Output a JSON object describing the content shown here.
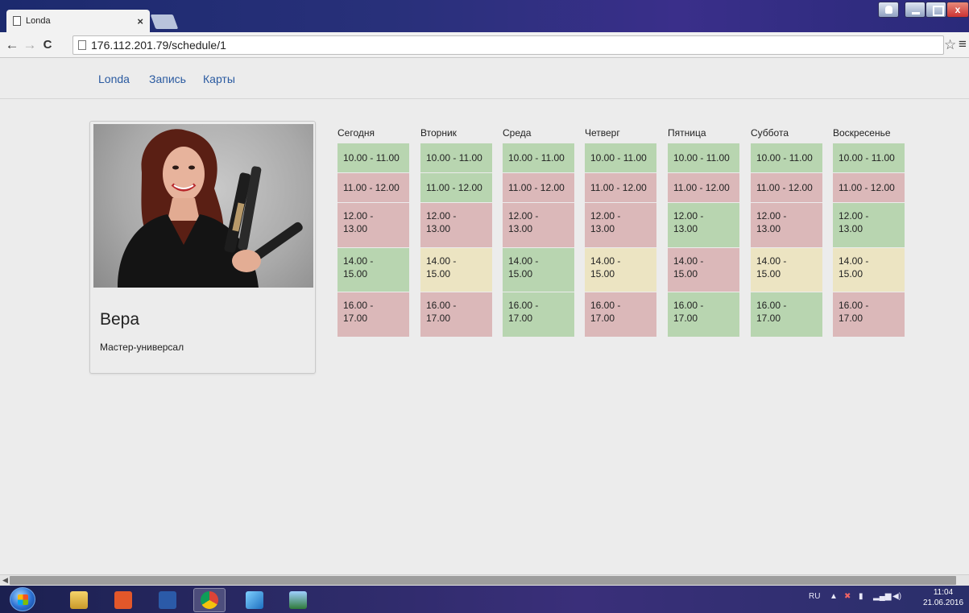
{
  "browser": {
    "tab_title": "Londa",
    "tab_close": "×",
    "url": "176.112.201.79/schedule/1",
    "back": "←",
    "forward": "→",
    "reload": "C",
    "star": "☆",
    "menu": "≡",
    "close_glyph": "x"
  },
  "nav": {
    "brand": "Londa",
    "links": [
      "Запись",
      "Карты"
    ]
  },
  "master": {
    "name": "Вера",
    "role": "Мастер-универсал"
  },
  "schedule": {
    "days": [
      {
        "label": "Сегодня",
        "slots": [
          "10.00 - 11.00",
          "11.00 - 12.00",
          "12.00 -\n13.00",
          "14.00 -\n15.00",
          "16.00 -\n17.00"
        ],
        "status": [
          "free",
          "busy",
          "busy",
          "free",
          "busy"
        ]
      },
      {
        "label": "Вторник",
        "slots": [
          "10.00 - 11.00",
          "11.00 - 12.00",
          "12.00 -\n13.00",
          "14.00 -\n15.00",
          "16.00 -\n17.00"
        ],
        "status": [
          "free",
          "free",
          "busy",
          "pending",
          "busy"
        ]
      },
      {
        "label": "Среда",
        "slots": [
          "10.00 - 11.00",
          "11.00 - 12.00",
          "12.00 -\n13.00",
          "14.00 -\n15.00",
          "16.00 -\n17.00"
        ],
        "status": [
          "free",
          "busy",
          "busy",
          "free",
          "free"
        ]
      },
      {
        "label": "Четверг",
        "slots": [
          "10.00 - 11.00",
          "11.00 - 12.00",
          "12.00 -\n13.00",
          "14.00 -\n15.00",
          "16.00 -\n17.00"
        ],
        "status": [
          "free",
          "busy",
          "busy",
          "pending",
          "busy"
        ]
      },
      {
        "label": "Пятница",
        "slots": [
          "10.00 - 11.00",
          "11.00 - 12.00",
          "12.00 -\n13.00",
          "14.00 -\n15.00",
          "16.00 -\n17.00"
        ],
        "status": [
          "free",
          "busy",
          "free",
          "busy",
          "free"
        ]
      },
      {
        "label": "Суббота",
        "slots": [
          "10.00 - 11.00",
          "11.00 - 12.00",
          "12.00 -\n13.00",
          "14.00 -\n15.00",
          "16.00 -\n17.00"
        ],
        "status": [
          "free",
          "busy",
          "busy",
          "pending",
          "free"
        ]
      },
      {
        "label": "Воскресенье",
        "slots": [
          "10.00 - 11.00",
          "11.00 - 12.00",
          "12.00 -\n13.00",
          "14.00 -\n15.00",
          "16.00 -\n17.00"
        ],
        "status": [
          "free",
          "busy",
          "free",
          "pending",
          "busy"
        ]
      }
    ],
    "colors": {
      "free": "#b8d5b0",
      "busy": "#dbb8b9",
      "pending": "#ece4c2"
    }
  },
  "taskbar": {
    "lang": "RU",
    "time": "11:04",
    "date": "21.06.2016"
  }
}
